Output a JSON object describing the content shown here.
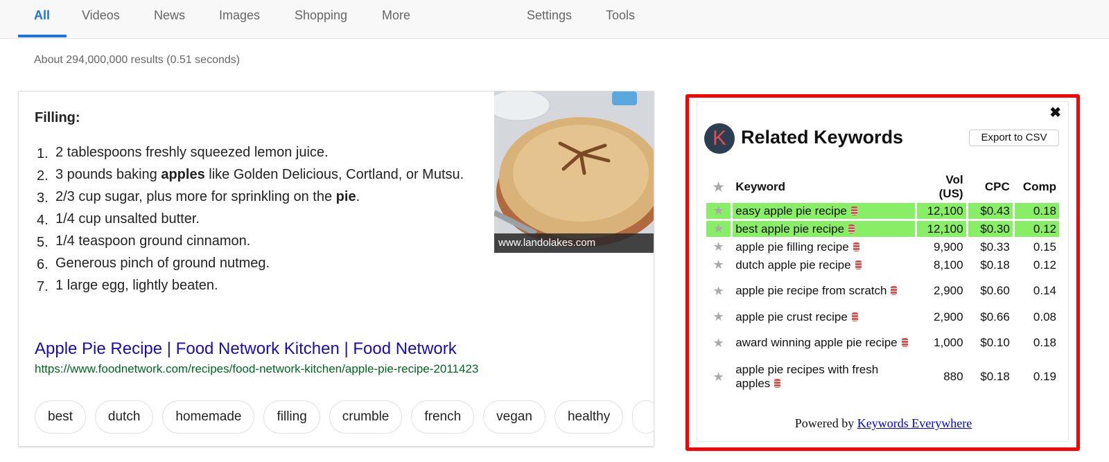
{
  "nav": {
    "tabs": [
      {
        "label": "All",
        "active": true
      },
      {
        "label": "Videos"
      },
      {
        "label": "News"
      },
      {
        "label": "Images"
      },
      {
        "label": "Shopping"
      },
      {
        "label": "More"
      }
    ],
    "settings_label": "Settings",
    "tools_label": "Tools",
    "accent_color": "#1a73e8"
  },
  "results_stats": "About 294,000,000 results (0.51 seconds)",
  "snippet": {
    "heading": "Filling:",
    "ingredients": [
      {
        "num": "1.",
        "pre": "2 tablespoons freshly squeezed lemon juice.",
        "bold": "",
        "post": ""
      },
      {
        "num": "2.",
        "pre": "3 pounds baking ",
        "bold": "apples",
        "post": " like Golden Delicious, Cortland, or Mutsu."
      },
      {
        "num": "3.",
        "pre": "2/3 cup sugar, plus more for sprinkling on the ",
        "bold": "pie",
        "post": "."
      },
      {
        "num": "4.",
        "pre": "1/4 cup unsalted butter.",
        "bold": "",
        "post": ""
      },
      {
        "num": "5.",
        "pre": "1/4 teaspoon ground cinnamon.",
        "bold": "",
        "post": ""
      },
      {
        "num": "6.",
        "pre": "Generous pinch of ground nutmeg.",
        "bold": "",
        "post": ""
      },
      {
        "num": "7.",
        "pre": "1 large egg, lightly beaten.",
        "bold": "",
        "post": ""
      }
    ],
    "image_caption": "www.landolakes.com",
    "result_title": "Apple Pie Recipe | Food Network Kitchen | Food Network",
    "result_url": "https://www.foodnetwork.com/recipes/food-network-kitchen/apple-pie-recipe-2011423",
    "chips": [
      "best",
      "dutch",
      "homemade",
      "filling",
      "crumble",
      "french",
      "vegan",
      "healthy"
    ]
  },
  "keywords_widget": {
    "logo_letter": "K",
    "title": "Related Keywords",
    "export_label": "Export to CSV",
    "close_icon": "✖",
    "columns": {
      "keyword": "Keyword",
      "vol": "Vol (US)",
      "cpc": "CPC",
      "comp": "Comp"
    },
    "rows": [
      {
        "keyword": "easy apple pie recipe",
        "vol": "12,100",
        "cpc": "$0.43",
        "comp": "0.18",
        "highlighted": true
      },
      {
        "keyword": "best apple pie recipe",
        "vol": "12,100",
        "cpc": "$0.30",
        "comp": "0.12",
        "highlighted": true
      },
      {
        "keyword": "apple pie filling recipe",
        "vol": "9,900",
        "cpc": "$0.33",
        "comp": "0.15",
        "highlighted": false
      },
      {
        "keyword": "dutch apple pie recipe",
        "vol": "8,100",
        "cpc": "$0.18",
        "comp": "0.12",
        "highlighted": false
      },
      {
        "keyword": "apple pie recipe from scratch",
        "vol": "2,900",
        "cpc": "$0.60",
        "comp": "0.14",
        "highlighted": false
      },
      {
        "keyword": "apple pie crust recipe",
        "vol": "2,900",
        "cpc": "$0.66",
        "comp": "0.08",
        "highlighted": false
      },
      {
        "keyword": "award winning apple pie recipe",
        "vol": "1,000",
        "cpc": "$0.10",
        "comp": "0.18",
        "highlighted": false
      },
      {
        "keyword": "apple pie recipes with fresh apples",
        "vol": "880",
        "cpc": "$0.18",
        "comp": "0.19",
        "highlighted": false
      }
    ],
    "powered_by": "Powered by",
    "powered_link": "Keywords Everywhere",
    "highlight_color": "#88ee66",
    "outline_color": "#ff0000"
  }
}
